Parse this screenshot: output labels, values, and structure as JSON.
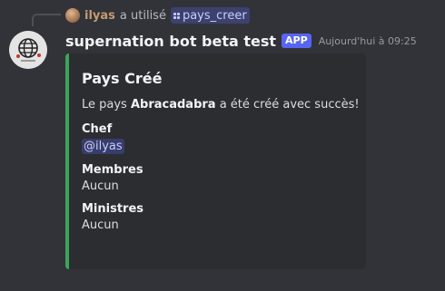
{
  "reply": {
    "user": "ilyas",
    "action": "a utilisé",
    "command": "pays_creer"
  },
  "message": {
    "bot_name": "supernation bot beta test",
    "badge": "APP",
    "timestamp": "Aujourd'hui à 09:25"
  },
  "embed": {
    "accent_color": "#3ba55c",
    "title": "Pays Créé",
    "description_prefix": "Le pays ",
    "description_country": "Abracadabra",
    "description_suffix": " a été créé avec succès!",
    "fields": [
      {
        "name": "Chef",
        "value": "@ilyas"
      },
      {
        "name": "Membres",
        "value": "Aucun"
      },
      {
        "name": "Ministres",
        "value": "Aucun"
      }
    ]
  }
}
